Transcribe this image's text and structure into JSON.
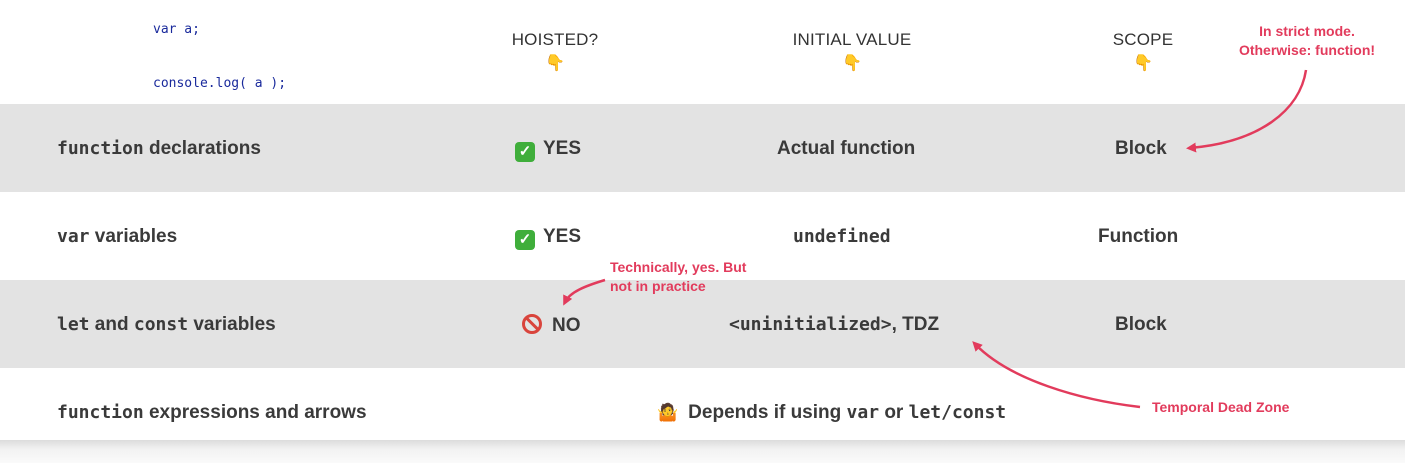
{
  "code": {
    "line1": "var a;",
    "line2": "console.log( a );"
  },
  "headers": {
    "hoisted": "HOISTED?",
    "initial_value": "INITIAL VALUE",
    "scope": "SCOPE",
    "pointer_icon": "pointing-down-hand"
  },
  "rows": [
    {
      "label_code": "function",
      "label_text": " declarations",
      "hoisted": "YES",
      "hoisted_icon": "check-icon",
      "initial": "Actual function",
      "scope": "Block"
    },
    {
      "label_code": "var",
      "label_text": " variables",
      "hoisted": "YES",
      "hoisted_icon": "check-icon",
      "initial": "undefined",
      "scope": "Function"
    },
    {
      "label_code1": "let",
      "label_mid": " and ",
      "label_code2": "const",
      "label_text": " variables",
      "hoisted": "NO",
      "hoisted_icon": "no-entry-icon",
      "initial_code": "<uninitialized>",
      "initial_text": ", TDZ",
      "scope": "Block"
    },
    {
      "label_code": "function",
      "label_text": " expressions and arrows",
      "combined_text1": "Depends if using ",
      "combined_code1": "var",
      "combined_text2": " or ",
      "combined_code2": "let/const",
      "combined_icon": "shrug-icon"
    }
  ],
  "notes": {
    "strict_line1": "In strict mode.",
    "strict_line2": "Otherwise: function!",
    "technically_line1": "Technically, yes. But",
    "technically_line2": "not in practice",
    "tdz": "Temporal Dead Zone"
  },
  "colors": {
    "accent": "#e23b5c",
    "row_gray": "#e3e3e3",
    "check_green": "#3fae3b"
  }
}
